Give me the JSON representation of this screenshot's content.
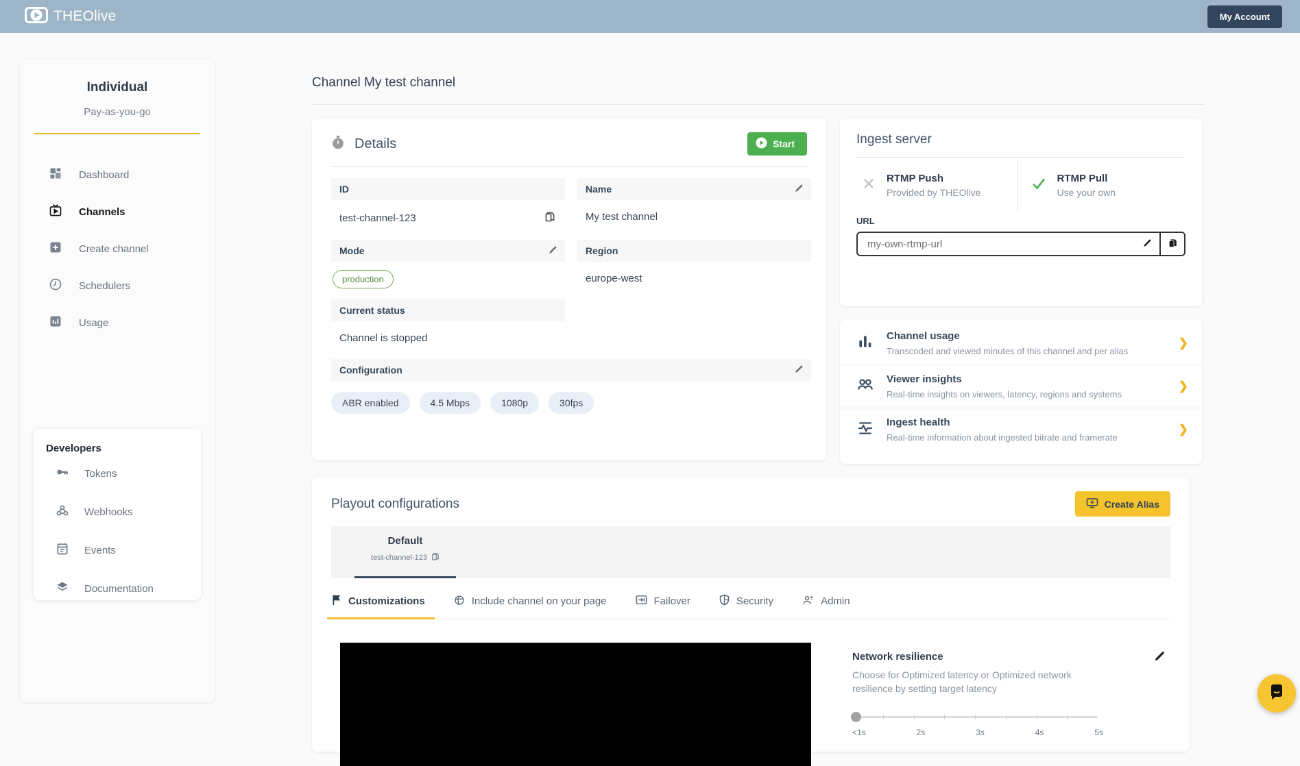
{
  "colors": {
    "accent_yellow": "#f2c230",
    "navy": "#32455c",
    "green": "#4caf50",
    "header_bg": "#9db5c6"
  },
  "header": {
    "brand": "THEOlive",
    "account_button": "My Account"
  },
  "sidebar": {
    "plan_name": "Individual",
    "plan_type": "Pay-as-you-go",
    "items": [
      {
        "label": "Dashboard",
        "icon": "dashboard-icon"
      },
      {
        "label": "Channels",
        "icon": "tv-icon",
        "active": true
      },
      {
        "label": "Create channel",
        "icon": "plus-square-icon"
      },
      {
        "label": "Schedulers",
        "icon": "clock-icon"
      },
      {
        "label": "Usage",
        "icon": "bar-chart-icon"
      }
    ],
    "developers": {
      "title": "Developers",
      "items": [
        {
          "label": "Tokens",
          "icon": "key-icon"
        },
        {
          "label": "Webhooks",
          "icon": "webhook-icon"
        },
        {
          "label": "Events",
          "icon": "calendar-icon"
        },
        {
          "label": "Documentation",
          "icon": "layers-icon"
        }
      ]
    }
  },
  "page": {
    "title": "Channel My test channel"
  },
  "details": {
    "title": "Details",
    "start_button": "Start",
    "fields": {
      "id": {
        "label": "ID",
        "value": "test-channel-123"
      },
      "name": {
        "label": "Name",
        "value": "My test channel"
      },
      "mode": {
        "label": "Mode",
        "value": "production"
      },
      "region": {
        "label": "Region",
        "value": "europe-west"
      },
      "status": {
        "label": "Current status",
        "value": "Channel is stopped"
      },
      "configuration": {
        "label": "Configuration",
        "chips": [
          "ABR enabled",
          "4.5 Mbps",
          "1080p",
          "30fps"
        ]
      }
    }
  },
  "ingest": {
    "title": "Ingest server",
    "push": {
      "title": "RTMP Push",
      "subtitle": "Provided by THEOlive"
    },
    "pull": {
      "title": "RTMP Pull",
      "subtitle": "Use your own"
    },
    "url_label": "URL",
    "url_value": "my-own-rtmp-url"
  },
  "links": [
    {
      "title": "Channel usage",
      "subtitle": "Transcoded and viewed minutes of this channel and per alias",
      "icon": "bar-chart-icon"
    },
    {
      "title": "Viewer insights",
      "subtitle": "Real-time insights on viewers, latency, regions and systems",
      "icon": "people-icon"
    },
    {
      "title": "Ingest health",
      "subtitle": "Real-time information about ingested bitrate and framerate",
      "icon": "pulse-icon"
    }
  ],
  "playout": {
    "title": "Playout configurations",
    "create_alias_button": "Create Alias",
    "alias_tab": {
      "name": "Default",
      "id": "test-channel-123"
    },
    "tabs": [
      {
        "label": "Customizations",
        "icon": "flag-icon",
        "active": true
      },
      {
        "label": "Include channel on your page",
        "icon": "globe-icon"
      },
      {
        "label": "Failover",
        "icon": "failover-icon"
      },
      {
        "label": "Security",
        "icon": "shield-icon"
      },
      {
        "label": "Admin",
        "icon": "admin-icon"
      }
    ],
    "network_resilience": {
      "title": "Network resilience",
      "description": "Choose for Optimized latency or Optimized network resilience by setting target latency",
      "slider_labels": [
        "<1s",
        "2s",
        "3s",
        "4s",
        "5s"
      ]
    }
  }
}
